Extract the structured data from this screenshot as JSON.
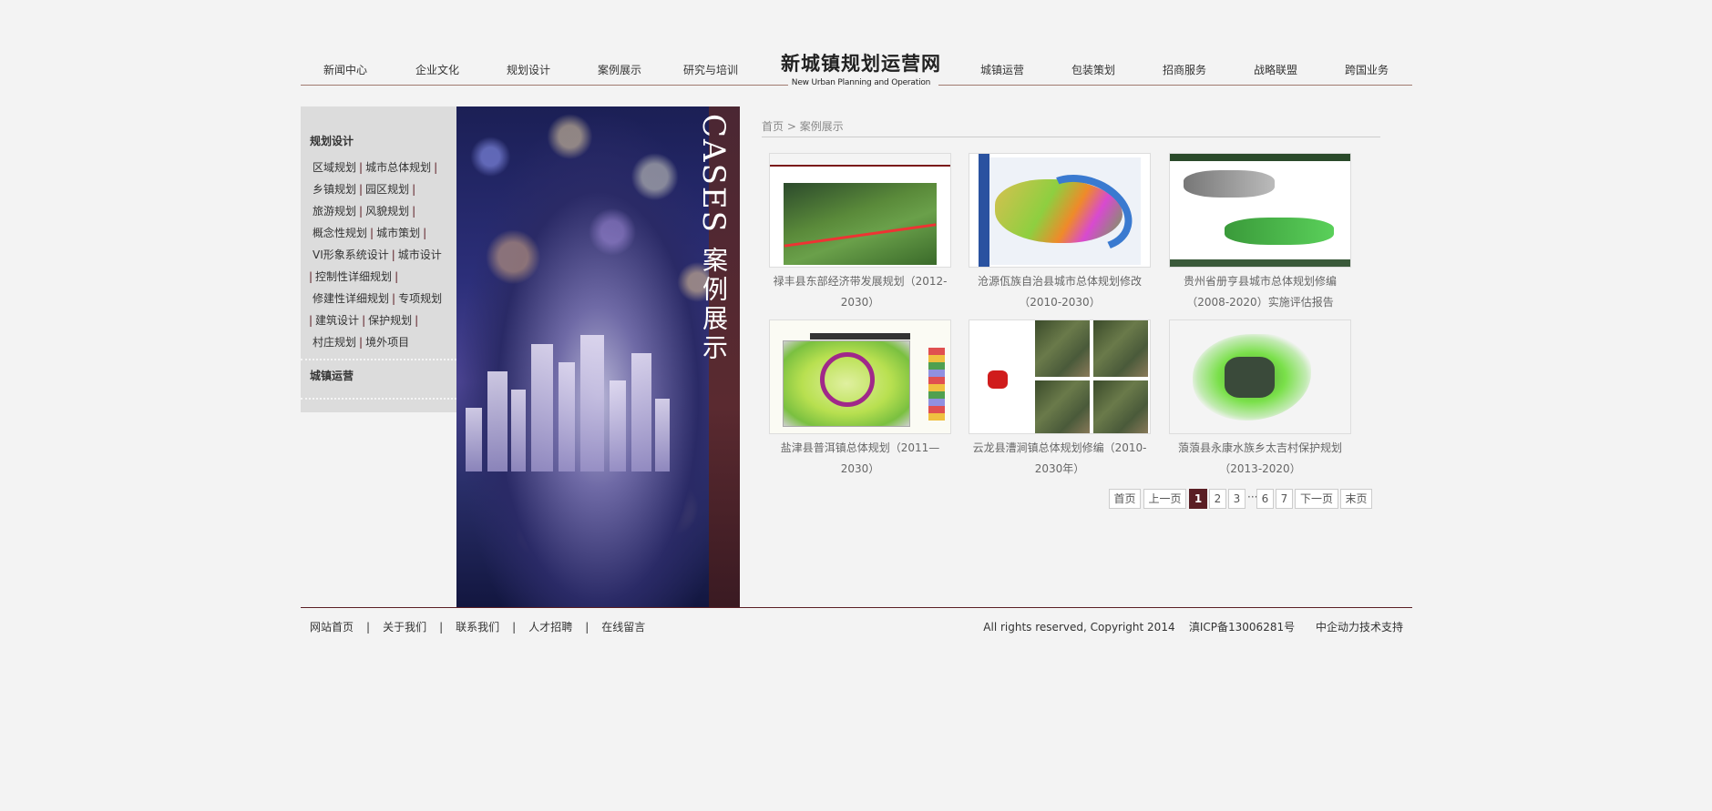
{
  "nav": {
    "left": [
      "新闻中心",
      "企业文化",
      "规划设计",
      "案例展示",
      "研究与培训"
    ],
    "right": [
      "城镇运营",
      "包装策划",
      "招商服务",
      "战略联盟",
      "跨国业务"
    ],
    "logo_cn": "新城镇规划运营网",
    "logo_en": "New Urban Planning and Operation"
  },
  "sidebar": {
    "section1_title": "规划设计",
    "links": [
      "区域规划",
      "城市总体规划",
      "乡镇规划",
      "园区规划",
      "旅游规划",
      "风貌规划",
      "概念性规划",
      "城市策划",
      "VI形象系统设计",
      "城市设计",
      "控制性详细规划",
      "修建性详细规划",
      "专项规划",
      "建筑设计",
      "保护规划",
      "村庄规划",
      "境外项目"
    ],
    "section2_title": "城镇运营"
  },
  "banner": {
    "en": "CASES",
    "cn": "案例展示"
  },
  "breadcrumb": {
    "home": "首页",
    "sep": ">",
    "current": "案例展示"
  },
  "cases": [
    {
      "line1": "禄丰县东部经济带发展规划（2012-",
      "line2": "2030）"
    },
    {
      "line1": "沧源佤族自治县城市总体规划修改",
      "line2": "（2010-2030）"
    },
    {
      "line1": "贵州省册亨县城市总体规划修编",
      "line2": "（2008-2020）实施评估报告"
    },
    {
      "line1": "盐津县普洱镇总体规划（2011—",
      "line2": "2030）"
    },
    {
      "line1": "云龙县漕涧镇总体规划修编（2010-",
      "line2": "2030年）"
    },
    {
      "line1": "蒗蒗县永康水族乡太吉村保护规划",
      "line2": "（2013-2020）"
    }
  ],
  "pager": {
    "first": "首页",
    "prev": "上一页",
    "pages": [
      "1",
      "2",
      "3"
    ],
    "ellipsis": "···",
    "pages2": [
      "6",
      "7"
    ],
    "next": "下一页",
    "last": "末页"
  },
  "footer": {
    "links": [
      "网站首页",
      "关于我们",
      "联系我们",
      "人才招聘",
      "在线留言"
    ],
    "sep": "|",
    "copyright": "All rights reserved, Copyright 2014",
    "icp": "滇ICP备13006281号",
    "support": "中企动力技术支持"
  }
}
